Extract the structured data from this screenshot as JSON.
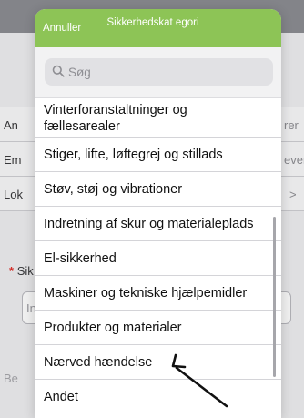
{
  "background": {
    "rows": [
      {
        "left": "An",
        "right": "rer"
      },
      {
        "left": "Em",
        "right": "ever"
      },
      {
        "left": "Lok",
        "right": ">"
      }
    ],
    "required_label": "Sik",
    "input_placeholder": "In",
    "footer_label": "Be"
  },
  "popover": {
    "cancel_label": "Annuller",
    "title": "Sikkerhedskat egori",
    "search": {
      "placeholder": "Søg"
    },
    "items": [
      "Vinterforanstaltninger og fællesarealer",
      "Stiger, lifte, løftegrej og stillads",
      "Støv, støj og vibrationer",
      "Indretning af skur og materialeplads",
      "El-sikkerhed",
      "Maskiner og tekniske hjælpemidler",
      "Produkter og materialer",
      "Nærved hændelse",
      "Andet"
    ]
  },
  "colors": {
    "header_green": "#8dc456",
    "annotation_arrow": "#111111"
  },
  "icons": {
    "search": "search-icon",
    "annotation": "arrow-icon"
  }
}
